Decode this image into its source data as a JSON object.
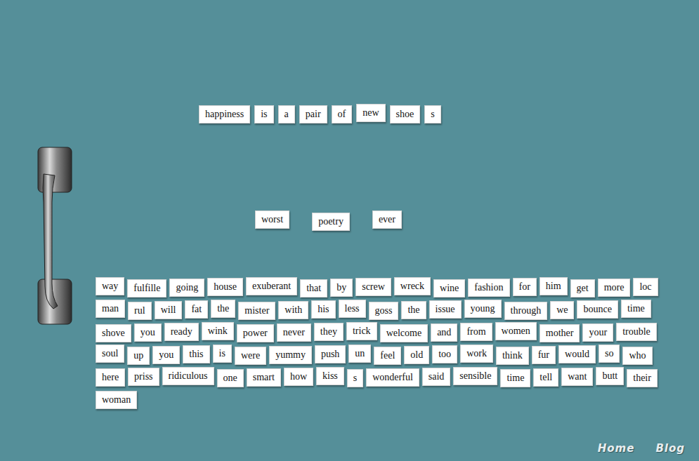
{
  "top_line": [
    "happiness",
    "is",
    "a",
    "pair",
    "of",
    "new",
    "shoe",
    "s"
  ],
  "middle_line": [
    "worst",
    "poetry",
    "ever"
  ],
  "pile": [
    "way",
    "fulfille",
    "going",
    "house",
    "exuberant",
    "that",
    "by",
    "screw",
    "wreck",
    "wine",
    "fashion",
    "for",
    "him",
    "get",
    "more",
    "loc",
    "man",
    "rul",
    "will",
    "fat",
    "the",
    "mister",
    "with",
    "his",
    "less",
    "goss",
    "the",
    "issue",
    "young",
    "through",
    "we",
    "bounce",
    "time",
    "shove",
    "you",
    "ready",
    "wink",
    "power",
    "never",
    "they",
    "trick",
    "welcome",
    "and",
    "from",
    "women",
    "mother",
    "your",
    "trouble",
    "soul",
    "up",
    "you",
    "this",
    "is",
    "were",
    "yummy",
    "push",
    "un",
    "feel",
    "old",
    "too",
    "work",
    "think",
    "fur",
    "would",
    "so",
    "who",
    "here",
    "priss",
    "ridiculous",
    "one",
    "smart",
    "how",
    "kiss",
    "s",
    "wonderful",
    "said",
    "sensible",
    "time",
    "tell",
    "want",
    "butt",
    "their",
    "woman"
  ],
  "nav": [
    "Home",
    "Blog"
  ]
}
